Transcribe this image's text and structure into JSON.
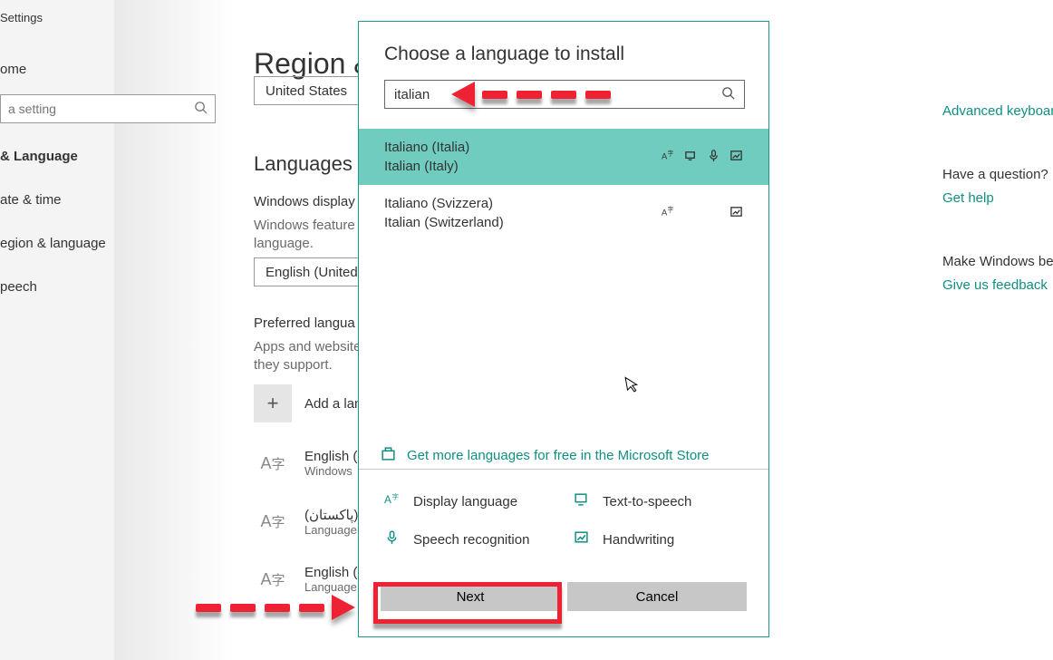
{
  "sidebar": {
    "title": "Settings",
    "home": "ome",
    "search_placeholder": "a setting",
    "items": [
      "& Language",
      "ate & time",
      "egion & language",
      "peech"
    ]
  },
  "main": {
    "page_title": "Region &",
    "country": "United States",
    "languages_header": "Languages",
    "display_line1": "Windows display",
    "display_line2": "Windows feature",
    "display_line3": "language.",
    "display_lang": "English (United",
    "preferred_header": "Preferred langua",
    "preferred_sub1": "Apps and website",
    "preferred_sub2": "they support.",
    "add_label": "Add a lan",
    "rows": [
      {
        "name": "English (U",
        "sub": "Windows"
      },
      {
        "name": "(پاکستان)",
        "sub": "Language"
      },
      {
        "name": "English (In",
        "sub": "Language"
      }
    ]
  },
  "rside": {
    "advanced": "Advanced keyboar",
    "question": "Have a question?",
    "gethelp": "Get help",
    "makebetter": "Make Windows be",
    "feedback": "Give us feedback"
  },
  "dialog": {
    "title": "Choose a language to install",
    "search_value": "italian",
    "results": [
      {
        "native": "Italiano (Italia)",
        "english": "Italian (Italy)",
        "selected": true,
        "icons": [
          "display",
          "tts",
          "speech",
          "hand"
        ]
      },
      {
        "native": "Italiano (Svizzera)",
        "english": "Italian (Switzerland)",
        "selected": false,
        "icons": [
          "display",
          "hand"
        ]
      }
    ],
    "store_link": "Get more languages for free in the Microsoft Store",
    "features": [
      "Display language",
      "Text-to-speech",
      "Speech recognition",
      "Handwriting"
    ],
    "next": "Next",
    "cancel": "Cancel"
  }
}
